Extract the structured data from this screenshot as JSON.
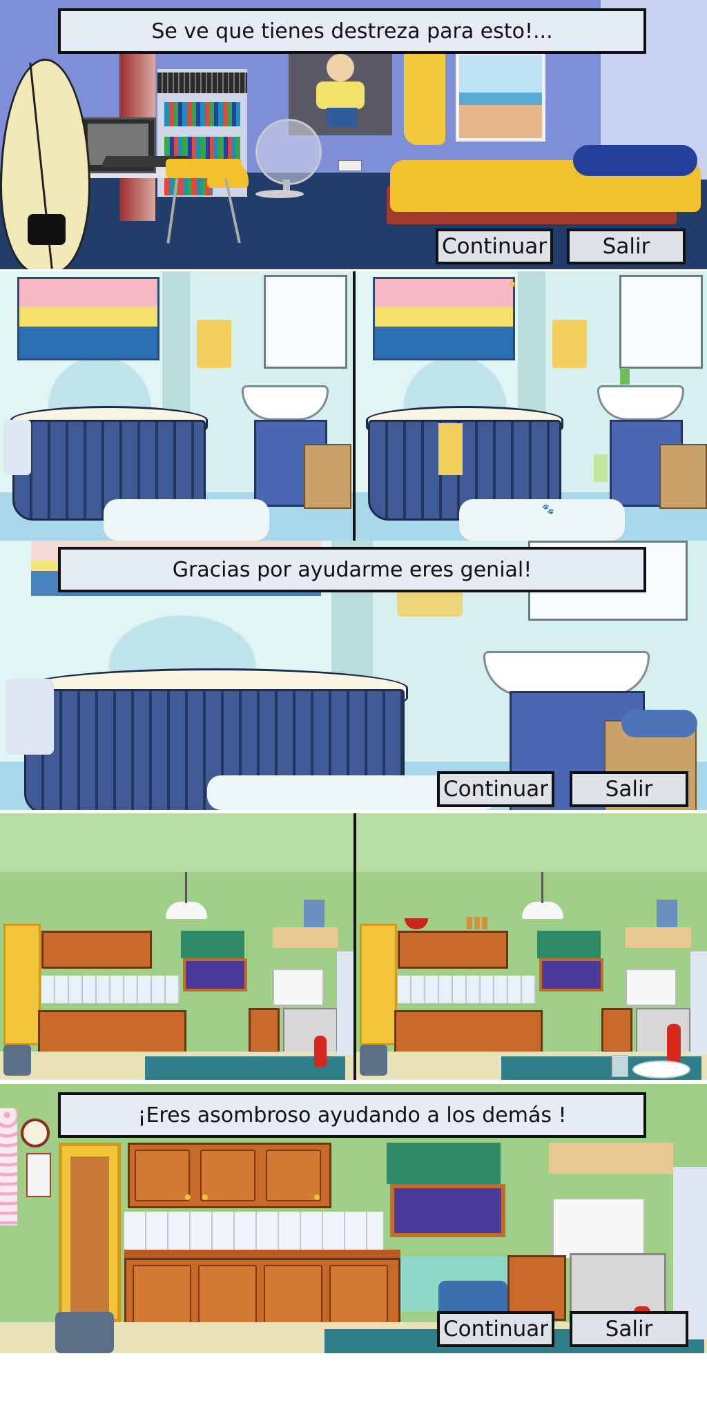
{
  "panels": {
    "bedroom": {
      "message": "Se ve que tienes destreza para esto!...",
      "continue_label": "Continuar",
      "exit_label": "Salir"
    },
    "bathroom": {
      "message": "Gracias por ayudarme eres genial!",
      "continue_label": "Continuar",
      "exit_label": "Salir"
    },
    "kitchen": {
      "message": "¡Eres asombroso ayudando a los demás !",
      "continue_label": "Continuar",
      "exit_label": "Salir"
    }
  },
  "colors": {
    "banner_bg": "#e6ecf6",
    "button_bg": "#dfe2e8",
    "border": "#111111",
    "bedroom_wall": "#7e8fd8",
    "bathroom_wall": "#d6f0f0",
    "kitchen_wall": "#9fce86"
  }
}
